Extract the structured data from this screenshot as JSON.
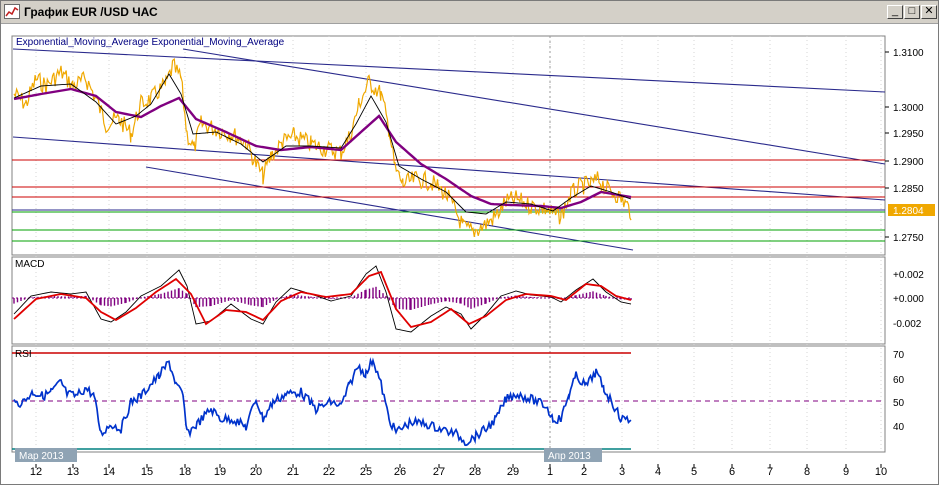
{
  "window": {
    "title": "График EUR /USD ЧАС",
    "buttons": {
      "minimize": "_",
      "maximize": "□",
      "close": "✕"
    }
  },
  "colors": {
    "price": "#f0a800",
    "ema_fast": "#000000",
    "ema_slow": "#800080",
    "channel": "#2a2a8c",
    "resistance": "#cc0000",
    "support": "#00a000",
    "macd_signal": "#e00000",
    "rsi": "#0033cc",
    "grid": "#c8c8c8",
    "price_label": "#f0a800"
  },
  "main_panel": {
    "indicator_label": "Exponential_Moving_Average Exponential_Moving_Average",
    "price_ticks": [
      "1.3100",
      "1.3000",
      "1.2950",
      "1.2900",
      "1.2850",
      "1.2800",
      "1.2750"
    ],
    "current_price": "1.2804"
  },
  "macd_panel": {
    "label": "MACD",
    "ticks": [
      "+0.002",
      "+0.000",
      "-0.002"
    ]
  },
  "rsi_panel": {
    "label": "RSI",
    "ticks": [
      "70",
      "60",
      "50",
      "40"
    ],
    "levels": [
      70,
      50,
      30
    ]
  },
  "time_axis": {
    "day_labels": [
      "12",
      "13",
      "14",
      "15",
      "18",
      "19",
      "20",
      "21",
      "22",
      "25",
      "26",
      "27",
      "28",
      "29",
      "1",
      "2",
      "3",
      "4",
      "5",
      "6",
      "7",
      "8",
      "9",
      "10"
    ],
    "month_labels": [
      "Мар 2013",
      "Апр 2013"
    ]
  }
}
